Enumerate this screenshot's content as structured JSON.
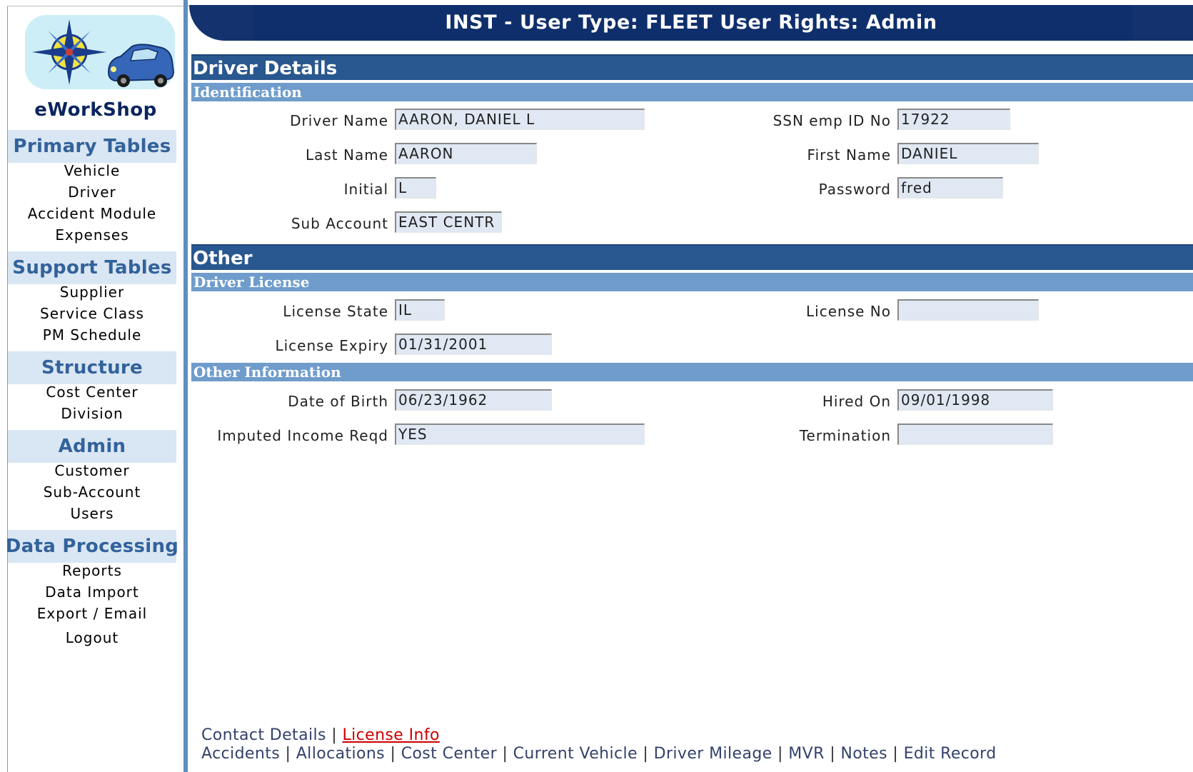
{
  "header": {
    "title": "INST - User Type: FLEET User Rights: Admin"
  },
  "sidebar": {
    "app_name": "eWorkShop",
    "sections": [
      {
        "title": "Primary Tables",
        "items": [
          "Vehicle",
          "Driver",
          "Accident Module",
          "Expenses"
        ]
      },
      {
        "title": "Support Tables",
        "items": [
          "Supplier",
          "Service Class",
          "PM Schedule"
        ]
      },
      {
        "title": "Structure",
        "items": [
          "Cost Center",
          "Division"
        ]
      },
      {
        "title": "Admin",
        "items": [
          "Customer",
          "Sub-Account",
          "Users"
        ]
      },
      {
        "title": "Data Processing",
        "items": [
          "Reports",
          "Data Import",
          "Export / Email"
        ]
      }
    ],
    "logout": "Logout"
  },
  "main": {
    "title": "Driver Details",
    "identification": {
      "title": "Identification",
      "driver_name": {
        "label": "Driver Name",
        "value": "AARON, DANIEL L"
      },
      "ssn": {
        "label": "SSN emp ID No",
        "value": "17922"
      },
      "last_name": {
        "label": "Last Name",
        "value": "AARON"
      },
      "first_name": {
        "label": "First Name",
        "value": "DANIEL"
      },
      "initial": {
        "label": "Initial",
        "value": "L"
      },
      "password": {
        "label": "Password",
        "value": "fred"
      },
      "sub_account": {
        "label": "Sub Account",
        "value": "EAST CENTR"
      }
    },
    "other": {
      "title": "Other",
      "license": {
        "title": "Driver License",
        "state": {
          "label": "License State",
          "value": "IL"
        },
        "number": {
          "label": "License No",
          "value": ""
        },
        "expiry": {
          "label": "License Expiry",
          "value": "01/31/2001"
        }
      },
      "info": {
        "title": "Other Information",
        "dob": {
          "label": "Date of Birth",
          "value": "06/23/1962"
        },
        "hired": {
          "label": "Hired On",
          "value": "09/01/1998"
        },
        "imputed": {
          "label": "Imputed Income Reqd",
          "value": "YES"
        },
        "termination": {
          "label": "Termination",
          "value": ""
        }
      }
    }
  },
  "footer": {
    "row1": [
      "Contact Details",
      "License Info"
    ],
    "row2": [
      "Accidents",
      "Allocations",
      "Cost Center",
      "Current Vehicle",
      "Driver Mileage",
      "MVR",
      "Notes",
      "Edit Record"
    ],
    "separator": "|"
  }
}
